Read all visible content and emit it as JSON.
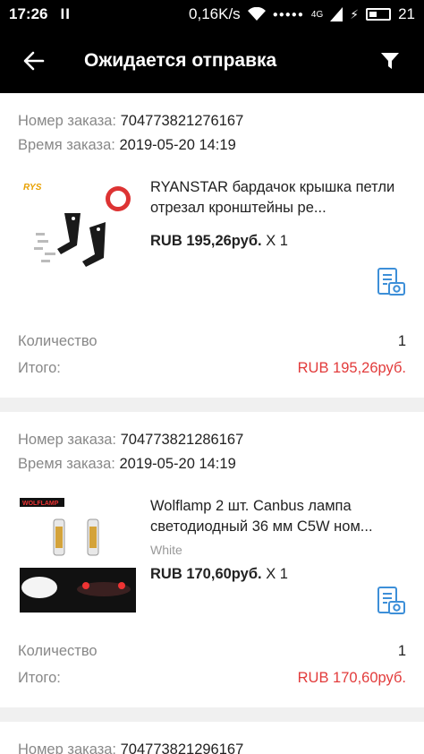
{
  "status": {
    "time": "17:26",
    "pause": "II",
    "speed": "0,16K/s",
    "network": "4G",
    "battery": "21"
  },
  "header": {
    "title": "Ожидается отправка"
  },
  "orders": [
    {
      "number_label": "Номер заказа:",
      "number": "704773821276167",
      "time_label": "Время заказа:",
      "time": "2019-05-20 14:19",
      "product_title": "RYANSTAR бардачок крышка петли отрезал кронштейны ре...",
      "variant": "",
      "price": "RUB 195,26руб.",
      "qty_mult": "X 1",
      "qty_label": "Количество",
      "qty": "1",
      "total_label": "Итого:",
      "total": "RUB 195,26руб."
    },
    {
      "number_label": "Номер заказа:",
      "number": "704773821286167",
      "time_label": "Время заказа:",
      "time": "2019-05-20 14:19",
      "product_title": "Wolflamp 2 шт. Canbus лампа светодиодный 36 мм C5W ном...",
      "variant": "White",
      "price": "RUB 170,60руб.",
      "qty_mult": "X 1",
      "qty_label": "Количество",
      "qty": "1",
      "total_label": "Итого:",
      "total": "RUB 170,60руб."
    },
    {
      "number_label": "Номер заказа:",
      "number": "704773821296167"
    }
  ],
  "colors": {
    "accent_red": "#e23b3b",
    "icon_blue": "#3d8fd8"
  }
}
